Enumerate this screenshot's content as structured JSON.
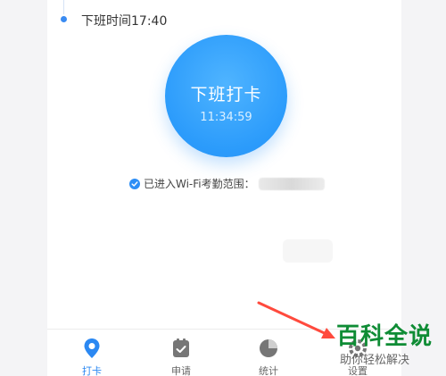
{
  "timeline": {
    "off_work_time": "下班时间17:40"
  },
  "punch": {
    "label": "下班打卡",
    "time": "11:34:59"
  },
  "wifi_status": {
    "text": "已进入Wi-Fi考勤范围："
  },
  "tabbar": {
    "items": [
      {
        "label": "打卡",
        "icon": "location-pin-icon",
        "active": true
      },
      {
        "label": "申请",
        "icon": "clipboard-check-icon",
        "active": false
      },
      {
        "label": "统计",
        "icon": "pie-chart-icon",
        "active": false
      },
      {
        "label": "设置",
        "icon": "gear-icon",
        "active": false
      }
    ]
  },
  "watermark": {
    "title": "百科全说",
    "subtitle": "助你轻松解决"
  },
  "colors": {
    "accent": "#2c92f7",
    "active_tab": "#2b88f2",
    "annotation_arrow": "#ff4a3d",
    "watermark_green": "#0f8c35"
  }
}
